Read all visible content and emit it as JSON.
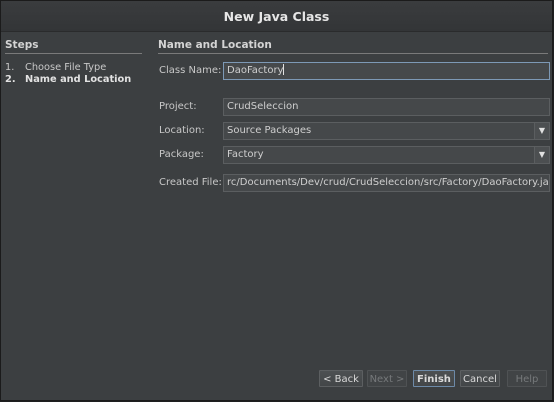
{
  "window": {
    "title": "New Java Class"
  },
  "steps": {
    "title": "Steps",
    "items": [
      {
        "num": "1.",
        "label": "Choose File Type",
        "active": false
      },
      {
        "num": "2.",
        "label": "Name and Location",
        "active": true
      }
    ]
  },
  "name_location": {
    "title": "Name and Location",
    "class_name": {
      "label": "Class Name:",
      "value": "DaoFactory"
    },
    "project": {
      "label": "Project:",
      "value": "CrudSeleccion"
    },
    "location": {
      "label": "Location:",
      "value": "Source Packages"
    },
    "package": {
      "label": "Package:",
      "value": "Factory"
    },
    "created_file": {
      "label": "Created File:",
      "value": "rc/Documents/Dev/crud/CrudSeleccion/src/Factory/DaoFactory.java"
    }
  },
  "buttons": {
    "back": "< Back",
    "next": "Next >",
    "finish": "Finish",
    "cancel": "Cancel",
    "help": "Help"
  },
  "icons": {
    "dropdown": "chevron-down-icon"
  },
  "colors": {
    "background": "#3c3f41",
    "focus_border": "#7d99b6",
    "text": "#c8c8c8"
  }
}
